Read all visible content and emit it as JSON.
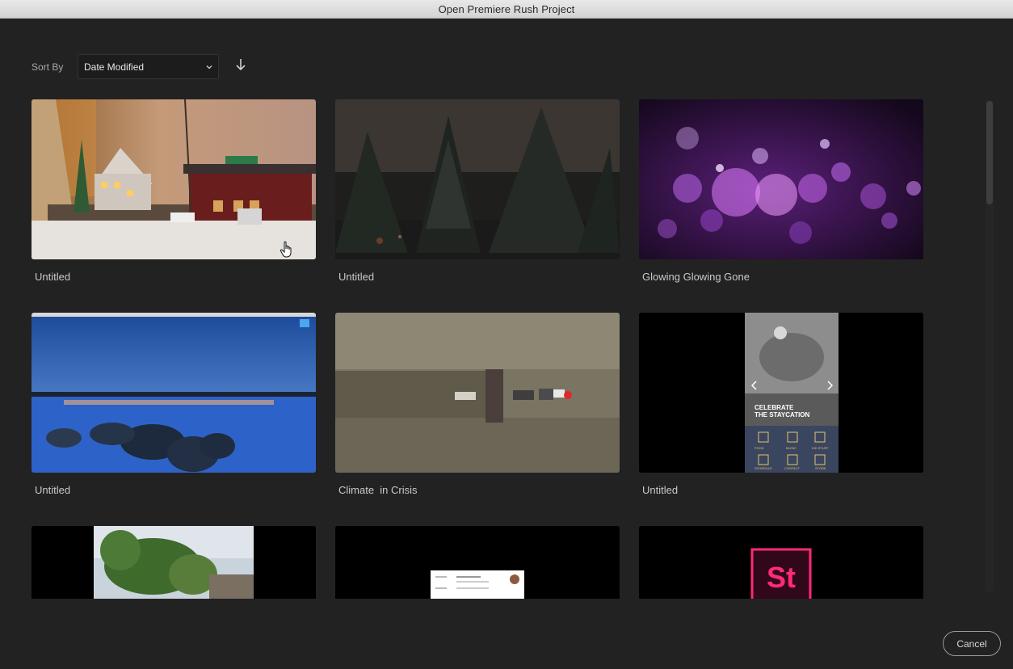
{
  "window": {
    "title": "Open Premiere Rush Project"
  },
  "sort": {
    "label": "Sort By",
    "selected": "Date Modified",
    "direction_icon": "arrow-down-icon"
  },
  "projects": [
    {
      "title": "Untitled",
      "thumbnail": "holiday-village-train"
    },
    {
      "title": "Untitled",
      "thumbnail": "snowy-forest-night"
    },
    {
      "title": "Glowing Glowing Gone",
      "thumbnail": "purple-bokeh"
    },
    {
      "title": "Untitled",
      "thumbnail": "lake-sunset-desktop"
    },
    {
      "title": "Climate  in Crisis",
      "thumbnail": "aerial-tractor-field"
    },
    {
      "title": "Untitled",
      "thumbnail": "staycation-phone-app"
    },
    {
      "title": "",
      "thumbnail": "island-trees"
    },
    {
      "title": "",
      "thumbnail": "contact-card"
    },
    {
      "title": "",
      "thumbnail": "stock-logo"
    }
  ],
  "thumb_text": {
    "staycation_heading": "CELEBRATE THE STAYCATION",
    "staycation_icons": [
      "FOOD",
      "MUSIC",
      "KID STUFF",
      "SCHEDULE",
      "CONTACT",
      "STORE"
    ],
    "logo_text": "St"
  },
  "actions": {
    "cancel_label": "Cancel"
  },
  "colors": {
    "background": "#222222",
    "accent_logo": "#ff2a7a"
  }
}
